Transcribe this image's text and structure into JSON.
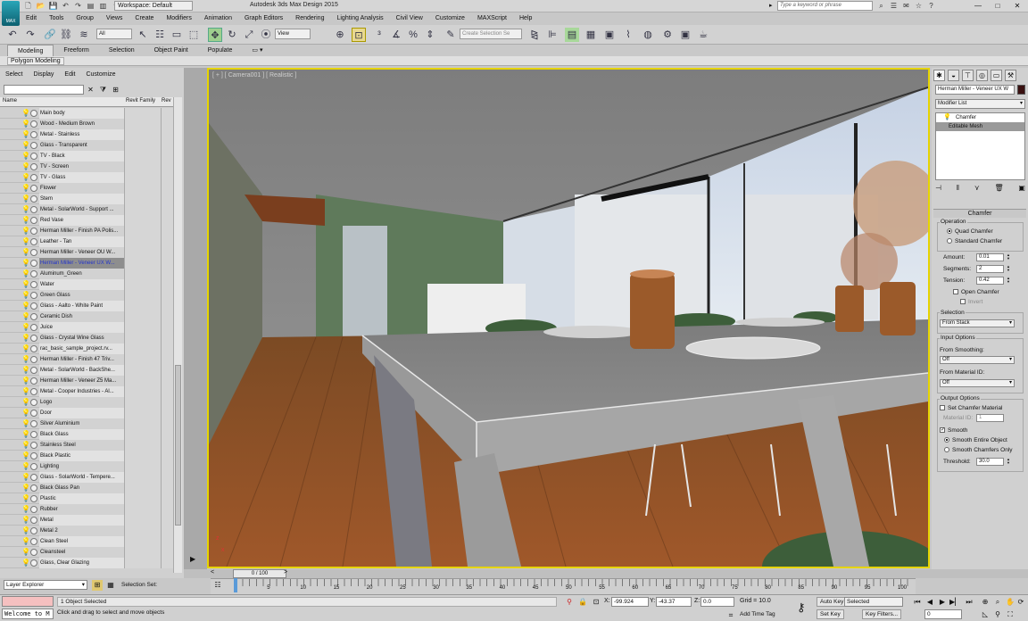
{
  "title_bar": {
    "logo": "MAX",
    "workspace": "Workspace: Default",
    "title": "Autodesk 3ds Max Design 2015",
    "search_placeholder": "Type a keyword or phrase",
    "minimize": "—",
    "maximize": "□",
    "close": "✕"
  },
  "menu": [
    "Edit",
    "Tools",
    "Group",
    "Views",
    "Create",
    "Modifiers",
    "Animation",
    "Graph Editors",
    "Rendering",
    "Lighting Analysis",
    "Civil View",
    "Customize",
    "MAXScript",
    "Help"
  ],
  "toolbar": {
    "selection_filter": "All",
    "ref_coord": "View",
    "named_selection_placeholder": "Create Selection Se"
  },
  "ribbon": {
    "tabs": [
      "Modeling",
      "Freeform",
      "Selection",
      "Object Paint",
      "Populate"
    ],
    "active_tab": "Modeling",
    "sub": "Polygon Modeling"
  },
  "explorer": {
    "menu": [
      "Select",
      "Display",
      "Edit",
      "Customize"
    ],
    "columns": [
      "Name",
      "Revit Family",
      "Rev"
    ],
    "layers": [
      "Main body",
      "Wood - Medium Brown",
      "Metal - Stainless",
      "Glass - Transparent",
      "TV - Black",
      "TV - Screen",
      "TV - Glass",
      "Flower",
      "Stem",
      "Metal - SolarWorld - Support ...",
      "Red Vase",
      "Herman Miller - Finish PA Polis...",
      "Leather - Tan",
      "Herman Miller - Veneer OU W...",
      "Herman Miller - Veneer UX W...",
      "Aluminum_Green",
      "Water",
      "Green Glass",
      "Glass - Aalto - White Paint",
      "Ceramic Dish",
      "Juice",
      "Glass - Crystal Wine Glass",
      "rac_basic_sample_project.rv...",
      "Herman Miller - Finish 47 Triv...",
      "Metal - SolarWorld - BackShe...",
      "Herman Miller - Veneer Z5 Ma...",
      "Metal - Cooper Industries - Al...",
      "Logo",
      "Door",
      "Silver Aluminium",
      "Black Glass",
      "Stainless Steel",
      "Black Plastic",
      "Lighting",
      "Glass - SolarWorld - Tempere...",
      "Black Glass Pan",
      "Plastic",
      "Rubber",
      "Metal",
      "Metal 2",
      "Clean Steel",
      "Cleansteel",
      "Glass, Clear Glazing"
    ],
    "selected_index": 14
  },
  "viewport": {
    "label": "[ + ] [ Camera001 ] [ Realistic ]",
    "axis_z": "z",
    "axis_x": "x"
  },
  "command_panel": {
    "object_name": "Herman Miller - Veneer UX W",
    "modifier_list": "Modifier List",
    "stack": [
      "Chamfer",
      "Editable Mesh"
    ],
    "rollout_title": "Chamfer",
    "operation": {
      "label": "Operation",
      "quad": "Quad Chamfer",
      "standard": "Standard Chamfer"
    },
    "amount_label": "Amount:",
    "amount": "0.01",
    "segments_label": "Segments:",
    "segments": "2",
    "tension_label": "Tension:",
    "tension": "0.42",
    "open_chamfer": "Open Chamfer",
    "invert": "Invert",
    "selection_label": "Selection",
    "selection_value": "From Stack",
    "input_options": "Input Options",
    "from_smoothing_label": "From Smoothing:",
    "from_smoothing": "Off",
    "from_material_label": "From Material ID:",
    "from_material": "Off",
    "output_options": "Output Options",
    "set_chamfer_material": "Set Chamfer Material",
    "material_id_label": "Material ID:",
    "material_id": "1",
    "smooth": "Smooth",
    "smooth_entire": "Smooth Entire Object",
    "smooth_chamfers": "Smooth Chamfers Only",
    "threshold_label": "Threshold:",
    "threshold": "30.0"
  },
  "timeline": {
    "slider": "0 / 100",
    "prev": "<",
    "next": ">",
    "ticks": [
      "0",
      "5",
      "10",
      "15",
      "20",
      "25",
      "30",
      "35",
      "40",
      "45",
      "50",
      "55",
      "60",
      "65",
      "70",
      "75",
      "80",
      "85",
      "90",
      "95",
      "100"
    ]
  },
  "bottom": {
    "layer_explorer": "Layer Explorer",
    "selection_set": "Selection Set:",
    "maxscript_1": "",
    "maxscript_2": "Welcome to M",
    "status_1": "1 Object Selected",
    "status_2": "Click and drag to select and move objects",
    "x_label": "X:",
    "x_value": "-99.924",
    "y_label": "Y:",
    "y_value": "-43.37",
    "z_label": "Z:",
    "z_value": "0.0",
    "grid": "Grid = 10.0",
    "add_time_tag": "Add Time Tag",
    "auto_key": "Auto Key",
    "set_key": "Set Key",
    "selected": "Selected",
    "key_filters": "Key Filters...",
    "frame": "0"
  }
}
